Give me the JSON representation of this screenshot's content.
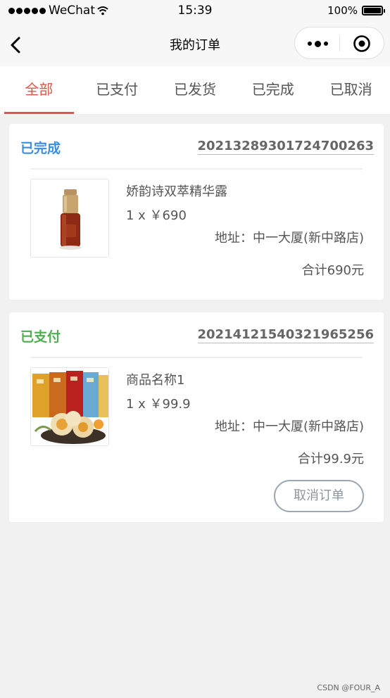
{
  "status_bar": {
    "carrier": "WeChat",
    "time": "15:39",
    "battery": "100%"
  },
  "nav": {
    "title": "我的订单"
  },
  "tabs": [
    {
      "label": "全部",
      "active": true
    },
    {
      "label": "已支付",
      "active": false
    },
    {
      "label": "已发货",
      "active": false
    },
    {
      "label": "已完成",
      "active": false
    },
    {
      "label": "已取消",
      "active": false
    }
  ],
  "orders": [
    {
      "status": "已完成",
      "status_color": "#3b8fe0",
      "order_id": "20213289301724700263",
      "product_name": "娇韵诗双萃精华露",
      "price_line": "1 x ￥690",
      "address": "地址：中一大厦(新中路店)",
      "total": "合计690元"
    },
    {
      "status": "已支付",
      "status_color": "#4cae4c",
      "order_id": "20214121540321965256",
      "product_name": "商品名称1",
      "price_line": "1 x ￥99.9",
      "address": "地址：中一大厦(新中路店)",
      "total": "合计99.9元",
      "action_label": "取消订单"
    }
  ],
  "watermark": "CSDN @FOUR_A",
  "colors": {
    "accent": "#e2544a",
    "completed": "#3b8fe0",
    "paid": "#4cae4c"
  }
}
